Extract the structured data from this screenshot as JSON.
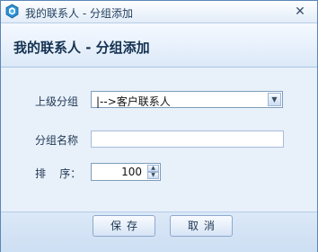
{
  "window": {
    "title": "我的联系人 - 分组添加",
    "close_symbol": "✕"
  },
  "header": {
    "title": "我的联系人 - 分组添加"
  },
  "form": {
    "parent_group": {
      "label": "上级分组",
      "selected": "|-->客户联系人"
    },
    "group_name": {
      "label": "分组名称",
      "value": ""
    },
    "sort_order": {
      "label": "排    序：",
      "value": "100"
    }
  },
  "buttons": {
    "save_label": "保存",
    "cancel_label": "取消"
  },
  "icons": {
    "app": "app-logo-icon",
    "close": "close-icon",
    "dropdown": "chevron-down-icon",
    "spin_up": "arrow-up-icon",
    "spin_down": "arrow-down-icon"
  },
  "colors": {
    "titlebar_text": "#24405f",
    "header_text": "#143252",
    "panel_bg": "#e8f0fa",
    "border": "#7f9db9"
  }
}
